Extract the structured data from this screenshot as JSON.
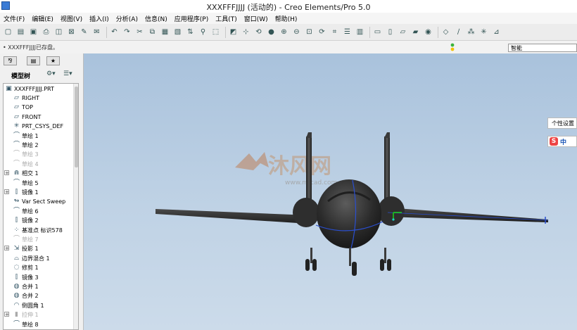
{
  "window": {
    "title": "XXXFFFJJJJ (活动的) - Creo Elements/Pro 5.0"
  },
  "menu": [
    "文件(F)",
    "编辑(E)",
    "视图(V)",
    "插入(I)",
    "分析(A)",
    "信息(N)",
    "应用程序(P)",
    "工具(T)",
    "窗口(W)",
    "帮助(H)"
  ],
  "message": "XXXFFFJJJJ已存盘。",
  "filter": {
    "value": "智能"
  },
  "tree_panel": {
    "title": "模型树",
    "root": "XXXFFFJJJJ.PRT",
    "items": [
      {
        "label": "RIGHT",
        "icon": "datum-plane-icon",
        "expand": false,
        "dim": false
      },
      {
        "label": "TOP",
        "icon": "datum-plane-icon",
        "expand": false,
        "dim": false
      },
      {
        "label": "FRONT",
        "icon": "datum-plane-icon",
        "expand": false,
        "dim": false
      },
      {
        "label": "PRT_CSYS_DEF",
        "icon": "csys-icon",
        "expand": false,
        "dim": false
      },
      {
        "label": "草绘 1",
        "icon": "sketch-icon",
        "expand": false,
        "dim": false
      },
      {
        "label": "草绘 2",
        "icon": "sketch-icon",
        "expand": false,
        "dim": false
      },
      {
        "label": "草绘 3",
        "icon": "sketch-icon",
        "expand": false,
        "dim": true
      },
      {
        "label": "草绘 4",
        "icon": "sketch-icon",
        "expand": false,
        "dim": true
      },
      {
        "label": "相交 1",
        "icon": "intersect-icon",
        "expand": true,
        "dim": false
      },
      {
        "label": "草绘 5",
        "icon": "sketch-icon",
        "expand": false,
        "dim": false
      },
      {
        "label": "镜像 1",
        "icon": "mirror-icon",
        "expand": true,
        "dim": false
      },
      {
        "label": "Var Sect Sweep",
        "icon": "sweep-icon",
        "expand": false,
        "dim": false
      },
      {
        "label": "草绘 6",
        "icon": "sketch-icon",
        "expand": false,
        "dim": false
      },
      {
        "label": "镜像 2",
        "icon": "mirror-icon",
        "expand": false,
        "dim": false
      },
      {
        "label": "基准点 标识578",
        "icon": "datum-point-icon",
        "expand": false,
        "dim": false
      },
      {
        "label": "草绘 7",
        "icon": "sketch-icon",
        "expand": false,
        "dim": true
      },
      {
        "label": "投影 1",
        "icon": "project-icon",
        "expand": true,
        "dim": false
      },
      {
        "label": "边界混合 1",
        "icon": "boundary-blend-icon",
        "expand": false,
        "dim": false
      },
      {
        "label": "修剪 1",
        "icon": "trim-icon",
        "expand": false,
        "dim": false
      },
      {
        "label": "镜像 3",
        "icon": "mirror-icon",
        "expand": false,
        "dim": false
      },
      {
        "label": "合并 1",
        "icon": "merge-icon",
        "expand": false,
        "dim": false
      },
      {
        "label": "合并 2",
        "icon": "merge-icon",
        "expand": false,
        "dim": false
      },
      {
        "label": "倒圆角 1",
        "icon": "round-icon",
        "expand": false,
        "dim": false
      },
      {
        "label": "拉伸 1",
        "icon": "extrude-icon",
        "expand": true,
        "dim": true
      },
      {
        "label": "草绘 8",
        "icon": "sketch-icon",
        "expand": false,
        "dim": false
      }
    ]
  },
  "popup": {
    "label": "个性设置"
  },
  "ime": {
    "logo": "S",
    "mode": "中"
  },
  "watermark": {
    "brand": "沐风网",
    "url": "www.mfcad.com"
  },
  "colors": {
    "viewport_top": "#a9c2dc",
    "viewport_bottom": "#ccdbea",
    "model": "#2b2b2b",
    "selection": "#2a4fd0"
  }
}
